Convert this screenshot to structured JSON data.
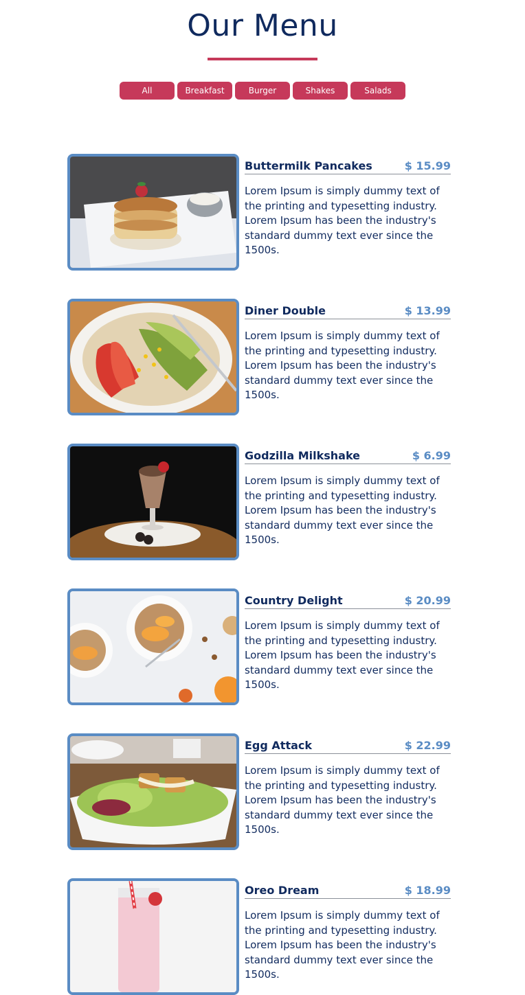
{
  "page": {
    "title": "Our Menu",
    "accent_color": "#c6395a",
    "heading_color": "#102a5e",
    "frame_color": "#5a8cc4"
  },
  "filters": [
    {
      "label": "All"
    },
    {
      "label": "Breakfast"
    },
    {
      "label": "Burger"
    },
    {
      "label": "Shakes"
    },
    {
      "label": "Salads"
    }
  ],
  "menu": [
    {
      "name": "Buttermilk Pancakes",
      "price": "$ 15.99",
      "description": "Lorem Ipsum is simply dummy text of the printing and typesetting industry. Lorem Ipsum has been the industry's standard dummy text ever since the 1500s.",
      "photo": "pancakes-photo"
    },
    {
      "name": "Diner Double",
      "price": "$ 13.99",
      "description": "Lorem Ipsum is simply dummy text of the printing and typesetting industry. Lorem Ipsum has been the industry's standard dummy text ever since the 1500s.",
      "photo": "avocado-tortilla-photo"
    },
    {
      "name": "Godzilla Milkshake",
      "price": "$ 6.99",
      "description": "Lorem Ipsum is simply dummy text of the printing and typesetting industry. Lorem Ipsum has been the industry's standard dummy text ever since the 1500s.",
      "photo": "milkshake-photo"
    },
    {
      "name": "Country Delight",
      "price": "$ 20.99",
      "description": "Lorem Ipsum is simply dummy text of the printing and typesetting industry. Lorem Ipsum has been the industry's standard dummy text ever since the 1500s.",
      "photo": "granola-bowls-photo"
    },
    {
      "name": "Egg Attack",
      "price": "$ 22.99",
      "description": "Lorem Ipsum is simply dummy text of the printing and typesetting industry. Lorem Ipsum has been the industry's standard dummy text ever since the 1500s.",
      "photo": "salad-photo"
    },
    {
      "name": "Oreo Dream",
      "price": "$ 18.99",
      "description": "Lorem Ipsum is simply dummy text of the printing and typesetting industry. Lorem Ipsum has been the industry's standard dummy text ever since the 1500s.",
      "photo": "strawberry-smoothie-photo"
    }
  ]
}
